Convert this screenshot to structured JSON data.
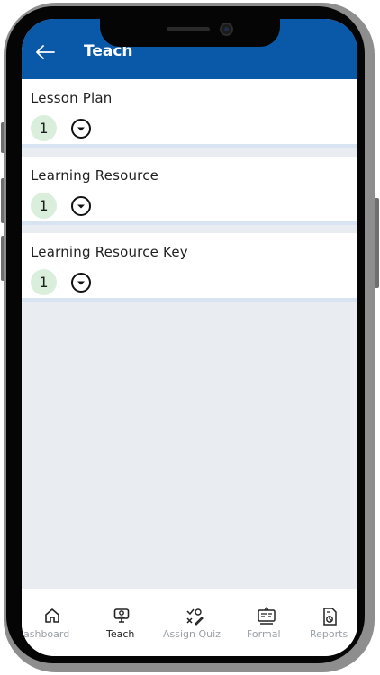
{
  "header": {
    "title": "Teach",
    "back_icon": "arrow-left-icon",
    "bg_color": "#0a59a8"
  },
  "sections": [
    {
      "title": "Lesson Plan",
      "count": "1",
      "toggle_icon": "chevron-down-circle-icon"
    },
    {
      "title": "Learning Resource",
      "count": "1",
      "toggle_icon": "chevron-down-circle-icon"
    },
    {
      "title": "Learning Resource Key",
      "count": "1",
      "toggle_icon": "chevron-down-circle-icon"
    }
  ],
  "bottom_nav": {
    "active": "Teach",
    "items": [
      {
        "label": "ashboard",
        "icon": "home-icon"
      },
      {
        "label": "Teach",
        "icon": "monitor-teacher-icon"
      },
      {
        "label": "Assign Quiz",
        "icon": "quiz-icon"
      },
      {
        "label": "Formal",
        "icon": "assessment-board-icon"
      },
      {
        "label": "Reports",
        "icon": "report-icon"
      }
    ]
  },
  "colors": {
    "badge_bg": "#d9efdc",
    "screen_bg": "#e9edf1",
    "active_nav": "#222222",
    "inactive_nav": "#9aa0a6"
  }
}
